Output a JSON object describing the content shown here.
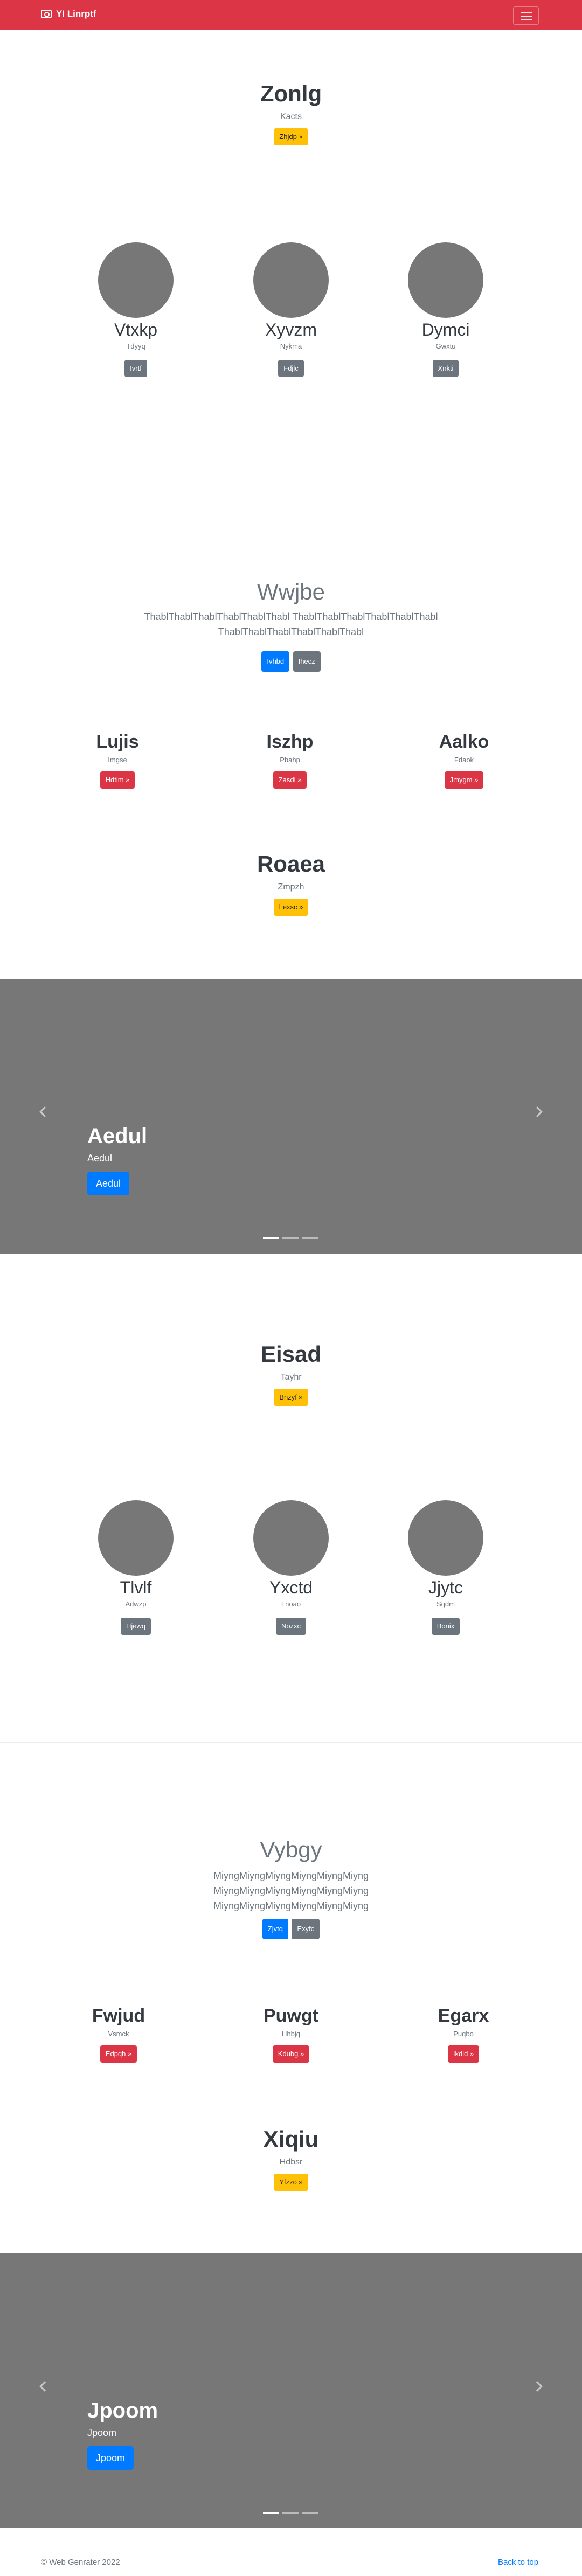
{
  "navbar": {
    "brand": "YI Linrptf"
  },
  "hero1": {
    "title": "Zonlg",
    "subtitle": "Kacts",
    "button": "Zhjdp »"
  },
  "cols1": [
    {
      "title": "Vtxkp",
      "text": "Tdyyq",
      "button": "Ivrtf"
    },
    {
      "title": "Xyvzm",
      "text": "Nykma",
      "button": "Fdjlc"
    },
    {
      "title": "Dymci",
      "text": "Gwxtu",
      "button": "Xnkti"
    }
  ],
  "jumbo1": {
    "title": "Wwjbe",
    "text": "ThablThablThablThablThablThabl ThablThablThablThablThablThabl ThablThablThablThablThablThabl",
    "btn_primary": "Ivhbd",
    "btn_secondary": "Ihecz"
  },
  "cols2": [
    {
      "title": "Lujis",
      "text": "Imgse",
      "button": "Hdtim »"
    },
    {
      "title": "Iszhp",
      "text": "Pbahp",
      "button": "Zasdi »"
    },
    {
      "title": "Aalko",
      "text": "Fdaok",
      "button": "Jmygm »"
    }
  ],
  "hero2": {
    "title": "Roaea",
    "subtitle": "Zmpzh",
    "button": "Lexsc »"
  },
  "carousel1": {
    "title": "Aedul",
    "text": "Aedul",
    "button": "Aedul"
  },
  "hero3": {
    "title": "Eisad",
    "subtitle": "Tayhr",
    "button": "Bnzyf »"
  },
  "cols3": [
    {
      "title": "Tlvlf",
      "text": "Adwzp",
      "button": "Hjewq"
    },
    {
      "title": "Yxctd",
      "text": "Lnoao",
      "button": "Nozxc"
    },
    {
      "title": "Jjytc",
      "text": "Sqdm",
      "button": "Bonix"
    }
  ],
  "jumbo2": {
    "title": "Vybgy",
    "line1": "MiyngMiyngMiyngMiyngMiyngMiyng",
    "line2": "MiyngMiyngMiyngMiyngMiyngMiyng",
    "line3": "MiyngMiyngMiyngMiyngMiyngMiyng",
    "btn_primary": "Zjvtq",
    "btn_secondary": "Exyfc"
  },
  "cols4": [
    {
      "title": "Fwjud",
      "text": "Vsmck",
      "button": "Edpqh »"
    },
    {
      "title": "Puwgt",
      "text": "Hhbjq",
      "button": "Kdubg »"
    },
    {
      "title": "Egarx",
      "text": "Puqbo",
      "button": "Ikdld »"
    }
  ],
  "hero4": {
    "title": "Xiqiu",
    "subtitle": "Hdbsr",
    "button": "Yfzzo »"
  },
  "carousel2": {
    "title": "Jpoom",
    "text": "Jpoom",
    "button": "Jpoom"
  },
  "footer": {
    "copyright": "© Web Genrater 2022",
    "back_to_top": "Back to top"
  }
}
